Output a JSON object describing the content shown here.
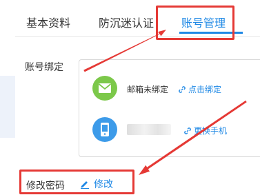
{
  "tabs": [
    {
      "label": "基本资料",
      "active": false
    },
    {
      "label": "防沉迷认证",
      "active": false
    },
    {
      "label": "账号管理",
      "active": true
    }
  ],
  "account_binding": {
    "label": "账号绑定",
    "email": {
      "status": "邮箱未绑定",
      "link": "点击绑定",
      "icon": "mail-icon"
    },
    "phone": {
      "link": "更换手机",
      "icon": "phone-icon"
    }
  },
  "password": {
    "label": "修改密码",
    "link": "修改",
    "icon": "pencil-icon"
  },
  "colors": {
    "accent": "#1e88e5",
    "annotation": "#e53935",
    "email_badge": "#7cc84a",
    "phone_badge": "#3d9be9"
  }
}
